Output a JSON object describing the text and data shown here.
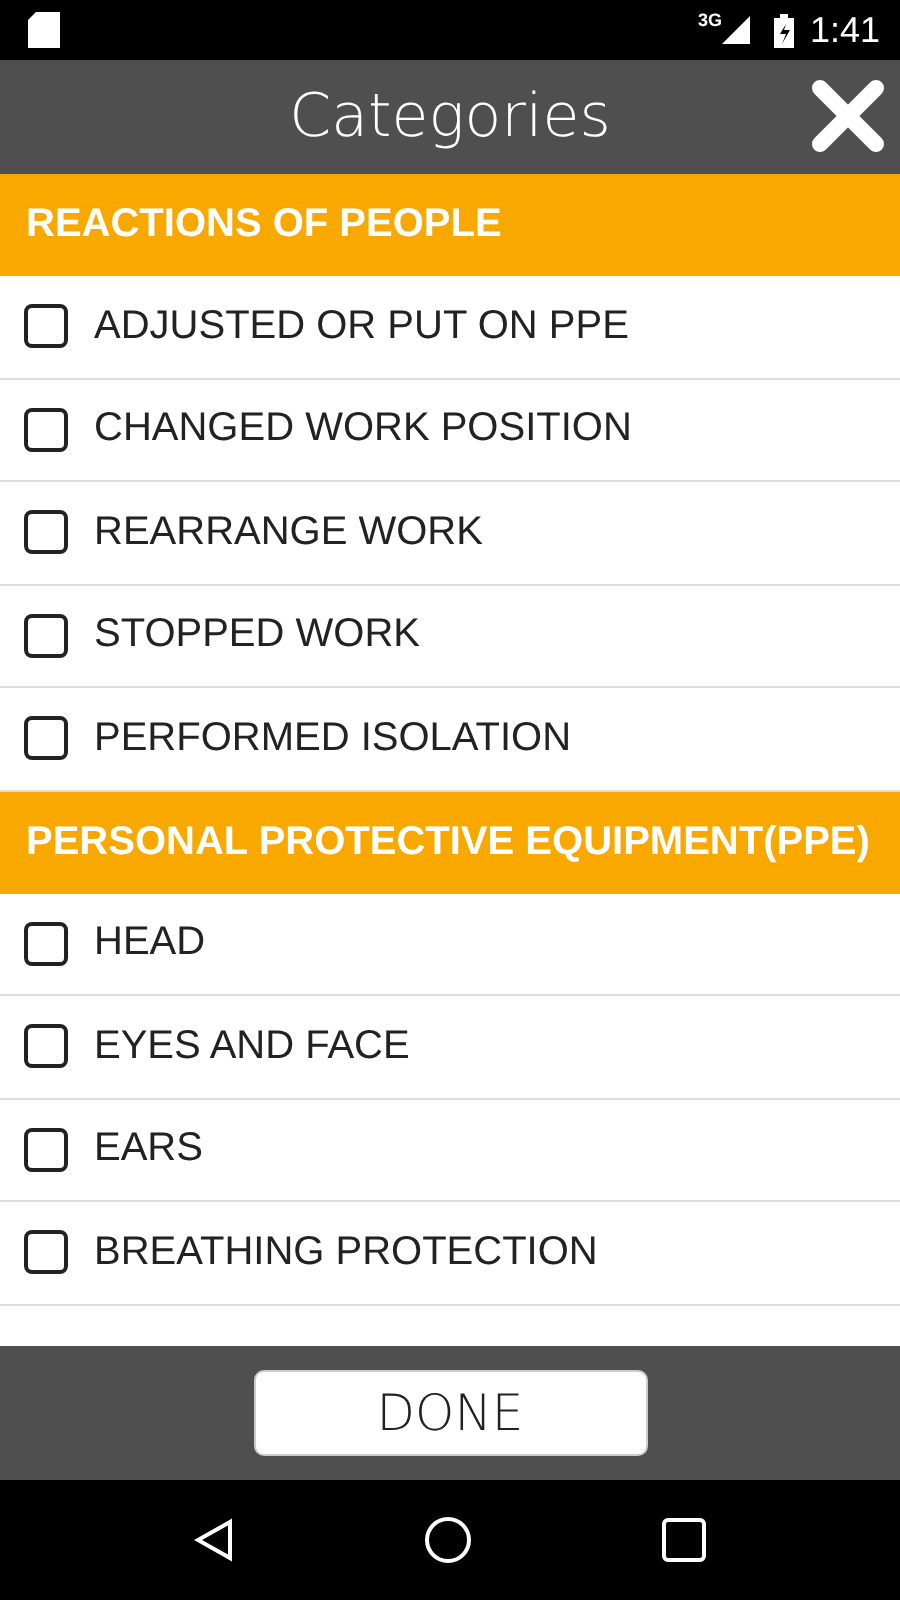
{
  "status_bar": {
    "network": "3G",
    "time": "1:41"
  },
  "header": {
    "title": "Categories"
  },
  "sections": [
    {
      "title": "REACTIONS OF PEOPLE",
      "items": [
        {
          "label": "ADJUSTED OR PUT ON PPE",
          "checked": false
        },
        {
          "label": "CHANGED WORK POSITION",
          "checked": false
        },
        {
          "label": "REARRANGE WORK",
          "checked": false
        },
        {
          "label": "STOPPED WORK",
          "checked": false
        },
        {
          "label": "PERFORMED ISOLATION",
          "checked": false
        }
      ]
    },
    {
      "title": "PERSONAL PROTECTIVE EQUIPMENT(PPE)",
      "items": [
        {
          "label": "HEAD",
          "checked": false
        },
        {
          "label": "EYES AND FACE",
          "checked": false
        },
        {
          "label": "EARS",
          "checked": false
        },
        {
          "label": "BREATHING PROTECTION",
          "checked": false
        }
      ]
    }
  ],
  "footer": {
    "button": "DONE"
  }
}
